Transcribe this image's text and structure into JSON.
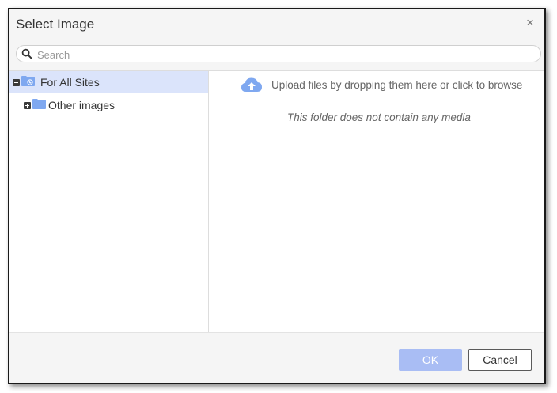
{
  "dialog": {
    "title": "Select Image",
    "close_glyph": "×",
    "close_icon": "close-icon"
  },
  "search": {
    "placeholder": "Search",
    "value": "",
    "icon": "search-icon"
  },
  "tree": {
    "items": [
      {
        "label": "For All Sites",
        "expanded": true,
        "selected": true,
        "icon": "globe-folder-icon"
      },
      {
        "label": "Other images",
        "expanded": false,
        "selected": false,
        "icon": "folder-icon"
      }
    ]
  },
  "content": {
    "upload_text": "Upload files by dropping them here or click to browse",
    "upload_icon": "cloud-upload-icon",
    "empty_text": "This folder does not contain any media"
  },
  "footer": {
    "ok_label": "OK",
    "cancel_label": "Cancel"
  },
  "colors": {
    "selected_row": "#dbe4fb",
    "folder": "#7fa8f0",
    "ok_button": "#a9bdf4"
  }
}
